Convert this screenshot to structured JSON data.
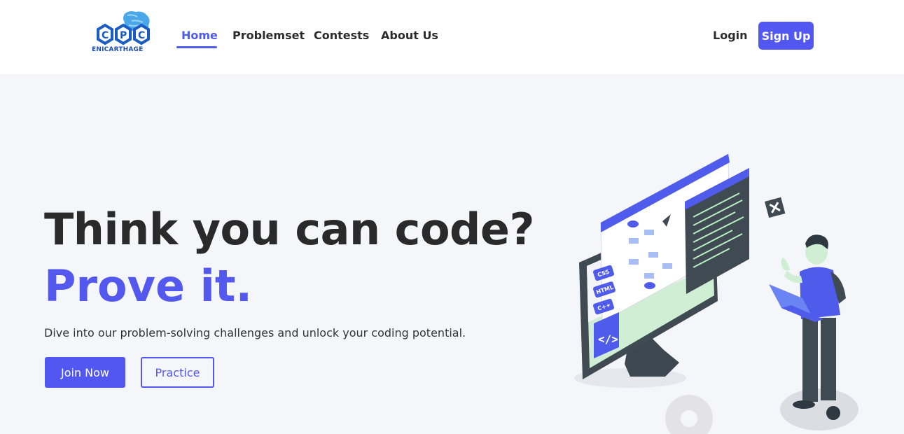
{
  "logo": {
    "letters": "CPC",
    "caption": "ENICARTHAGE"
  },
  "nav": {
    "items": [
      {
        "label": "Home",
        "active": true
      },
      {
        "label": "Problemset",
        "active": false
      },
      {
        "label": "Contests",
        "active": false
      },
      {
        "label": "About Us",
        "active": false
      }
    ],
    "login_label": "Login",
    "signup_label": "Sign Up"
  },
  "hero": {
    "headline": "Think you can code?",
    "accent": "Prove it.",
    "subtext": "Dive into our problem-solving challenges and unlock your coding potential.",
    "primary_button": "Join Now",
    "secondary_button": "Practice"
  },
  "illustration": {
    "tags": [
      "CSS",
      "HTML",
      "C++"
    ],
    "code_symbol": "</>"
  },
  "colors": {
    "accent": "#5357f2",
    "text": "#2a2a2a",
    "background": "#f5f6fa"
  }
}
